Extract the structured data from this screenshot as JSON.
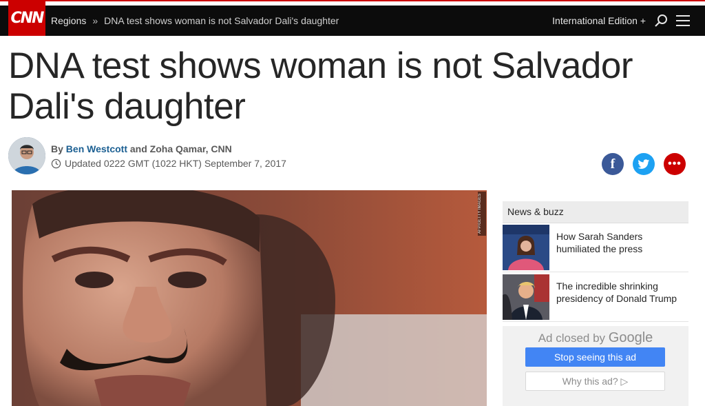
{
  "nav": {
    "logo": "CNN",
    "breadcrumb_section": "Regions",
    "breadcrumb_sep": "»",
    "breadcrumb_current": "DNA test shows woman is not Salvador Dali's daughter",
    "edition": "International Edition +"
  },
  "article": {
    "headline": "DNA test shows woman is not Salvador Dali's daughter",
    "by_prefix": "By",
    "author1": "Ben Westcott",
    "and": "and Zoha Qamar, CNN",
    "updated": "Updated 0222 GMT (1022 HKT) September 7, 2017",
    "photo_credit": "AFP/GETTY IMAGES"
  },
  "share": {
    "facebook": "f",
    "twitter": "twitter-icon",
    "more": "•••"
  },
  "sidebar": {
    "heading": "News & buzz",
    "items": [
      {
        "title": "How Sarah Sanders humiliated the press"
      },
      {
        "title": "The incredible shrinking presidency of Donald Trump"
      }
    ]
  },
  "ad": {
    "closed_by": "Ad closed by",
    "brand": "Google",
    "stop_label": "Stop seeing this ad",
    "why_label": "Why this ad? ▷"
  },
  "colors": {
    "brand_red": "#cc0000",
    "nav_bg": "#0c0c0c",
    "link_blue": "#1b5f92",
    "ad_blue": "#4285f4"
  }
}
